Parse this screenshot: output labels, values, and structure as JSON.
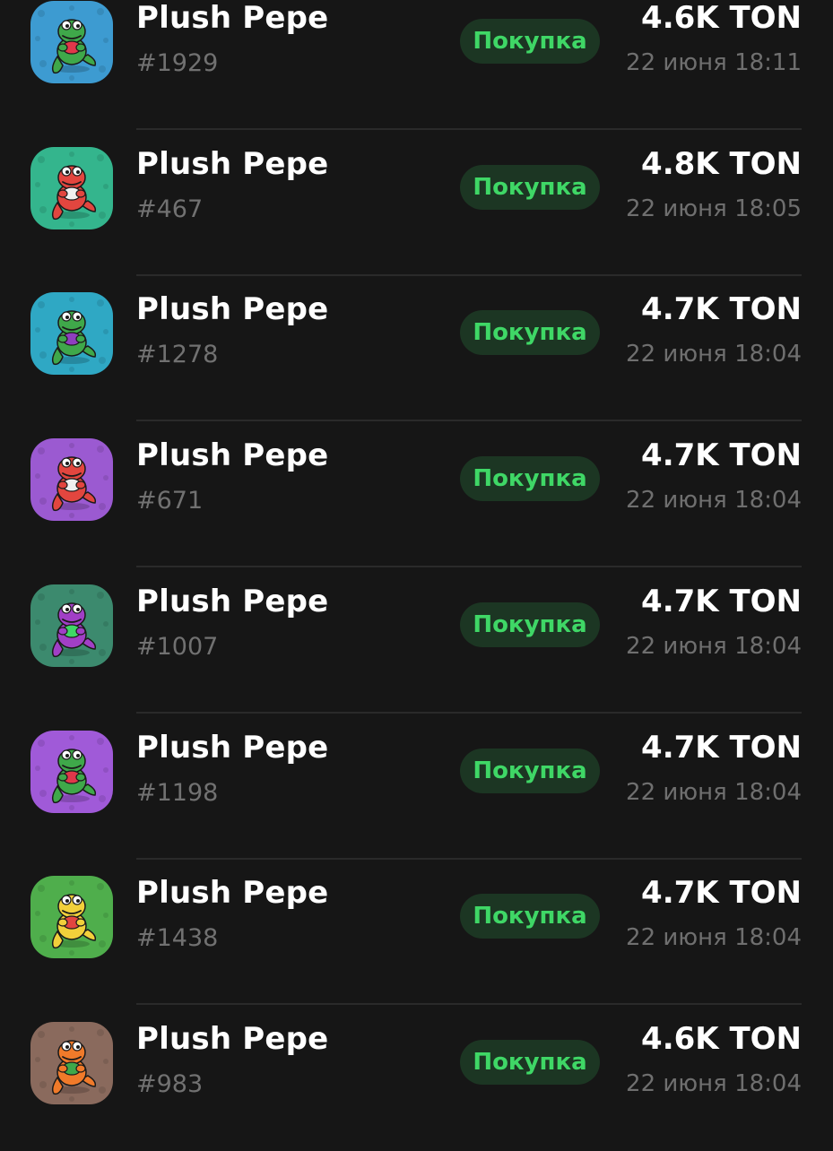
{
  "items": [
    {
      "name": "Plush Pepe",
      "number": "#1929",
      "badge": "Покупка",
      "price": "4.6K TON",
      "time": "22 июня 18:11",
      "bg": "#3d9bd1",
      "body": "#3fa84a",
      "accent": "#e0374a"
    },
    {
      "name": "Plush Pepe",
      "number": "#467",
      "badge": "Покупка",
      "price": "4.8K TON",
      "time": "22 июня 18:05",
      "bg": "#34b58d",
      "body": "#e2463f",
      "accent": "#f0f0f0"
    },
    {
      "name": "Plush Pepe",
      "number": "#1278",
      "badge": "Покупка",
      "price": "4.7K TON",
      "time": "22 июня 18:04",
      "bg": "#2fa8c4",
      "body": "#3fa84a",
      "accent": "#8e3fbf"
    },
    {
      "name": "Plush Pepe",
      "number": "#671",
      "badge": "Покупка",
      "price": "4.7K TON",
      "time": "22 июня 18:04",
      "bg": "#9b5ad1",
      "body": "#e2463f",
      "accent": "#f0f0f0"
    },
    {
      "name": "Plush Pepe",
      "number": "#1007",
      "badge": "Покупка",
      "price": "4.7K TON",
      "time": "22 июня 18:04",
      "bg": "#3c8a6e",
      "body": "#a13fc6",
      "accent": "#3fd766"
    },
    {
      "name": "Plush Pepe",
      "number": "#1198",
      "badge": "Покупка",
      "price": "4.7K TON",
      "time": "22 июня 18:04",
      "bg": "#a05ad8",
      "body": "#3fa84a",
      "accent": "#e0374a"
    },
    {
      "name": "Plush Pepe",
      "number": "#1438",
      "badge": "Покупка",
      "price": "4.7K TON",
      "time": "22 июня 18:04",
      "bg": "#4fae4c",
      "body": "#f2d03b",
      "accent": "#e2463f"
    },
    {
      "name": "Plush Pepe",
      "number": "#983",
      "badge": "Покупка",
      "price": "4.6K TON",
      "time": "22 июня 18:04",
      "bg": "#8a6a5d",
      "body": "#f07a2a",
      "accent": "#3fa84a"
    }
  ]
}
